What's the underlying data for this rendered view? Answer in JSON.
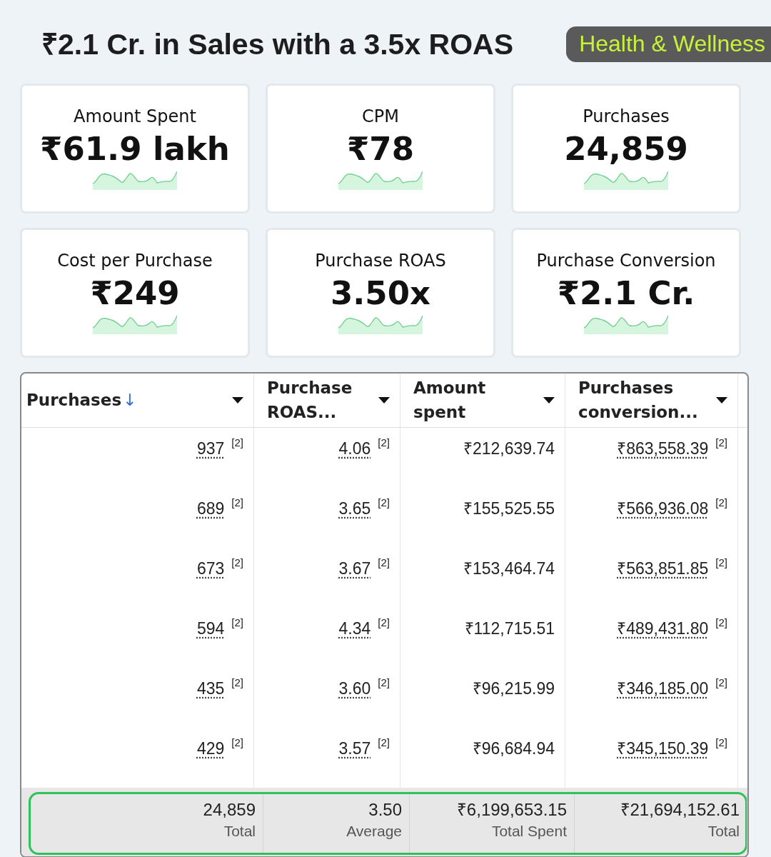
{
  "headline": "₹2.1 Cr. in Sales with a 3.5x ROAS",
  "category_badge": "Health & Wellness",
  "metrics": [
    {
      "label": "Amount Spent",
      "value": "₹61.9 lakh"
    },
    {
      "label": "CPM",
      "value": "₹78"
    },
    {
      "label": "Purchases",
      "value": "24,859"
    },
    {
      "label": "Cost per Purchase",
      "value": "₹249"
    },
    {
      "label": "Purchase ROAS",
      "value": "3.50x"
    },
    {
      "label": "Purchase Conversion",
      "value": "₹2.1 Cr."
    }
  ],
  "table": {
    "columns": [
      {
        "label": "Purchases",
        "sort_mark": "↓"
      },
      {
        "label": "Purchase ROAS..."
      },
      {
        "label": "Amount spent"
      },
      {
        "label": "Purchases conversion..."
      }
    ],
    "rows": [
      [
        {
          "value": "937",
          "note": "[2]"
        },
        {
          "value": "4.06",
          "note": "[2]"
        },
        {
          "value": "₹212,639.74"
        },
        {
          "value": "₹863,558.39",
          "note": "[2]"
        }
      ],
      [
        {
          "value": "689",
          "note": "[2]"
        },
        {
          "value": "3.65",
          "note": "[2]"
        },
        {
          "value": "₹155,525.55"
        },
        {
          "value": "₹566,936.08",
          "note": "[2]"
        }
      ],
      [
        {
          "value": "673",
          "note": "[2]"
        },
        {
          "value": "3.67",
          "note": "[2]"
        },
        {
          "value": "₹153,464.74"
        },
        {
          "value": "₹563,851.85",
          "note": "[2]"
        }
      ],
      [
        {
          "value": "594",
          "note": "[2]"
        },
        {
          "value": "4.34",
          "note": "[2]"
        },
        {
          "value": "₹112,715.51"
        },
        {
          "value": "₹489,431.80",
          "note": "[2]"
        }
      ],
      [
        {
          "value": "435",
          "note": "[2]"
        },
        {
          "value": "3.60",
          "note": "[2]"
        },
        {
          "value": "₹96,215.99"
        },
        {
          "value": "₹346,185.00",
          "note": "[2]"
        }
      ],
      [
        {
          "value": "429",
          "note": "[2]"
        },
        {
          "value": "3.57",
          "note": "[2]"
        },
        {
          "value": "₹96,684.94"
        },
        {
          "value": "₹345,150.39",
          "note": "[2]"
        }
      ]
    ],
    "totals": [
      {
        "value": "24,859",
        "label": "Total"
      },
      {
        "value": "3.50",
        "label": "Average"
      },
      {
        "value": "₹6,199,653.15",
        "label": "Total Spent"
      },
      {
        "value": "₹21,694,152.61",
        "label": "Total"
      }
    ]
  }
}
